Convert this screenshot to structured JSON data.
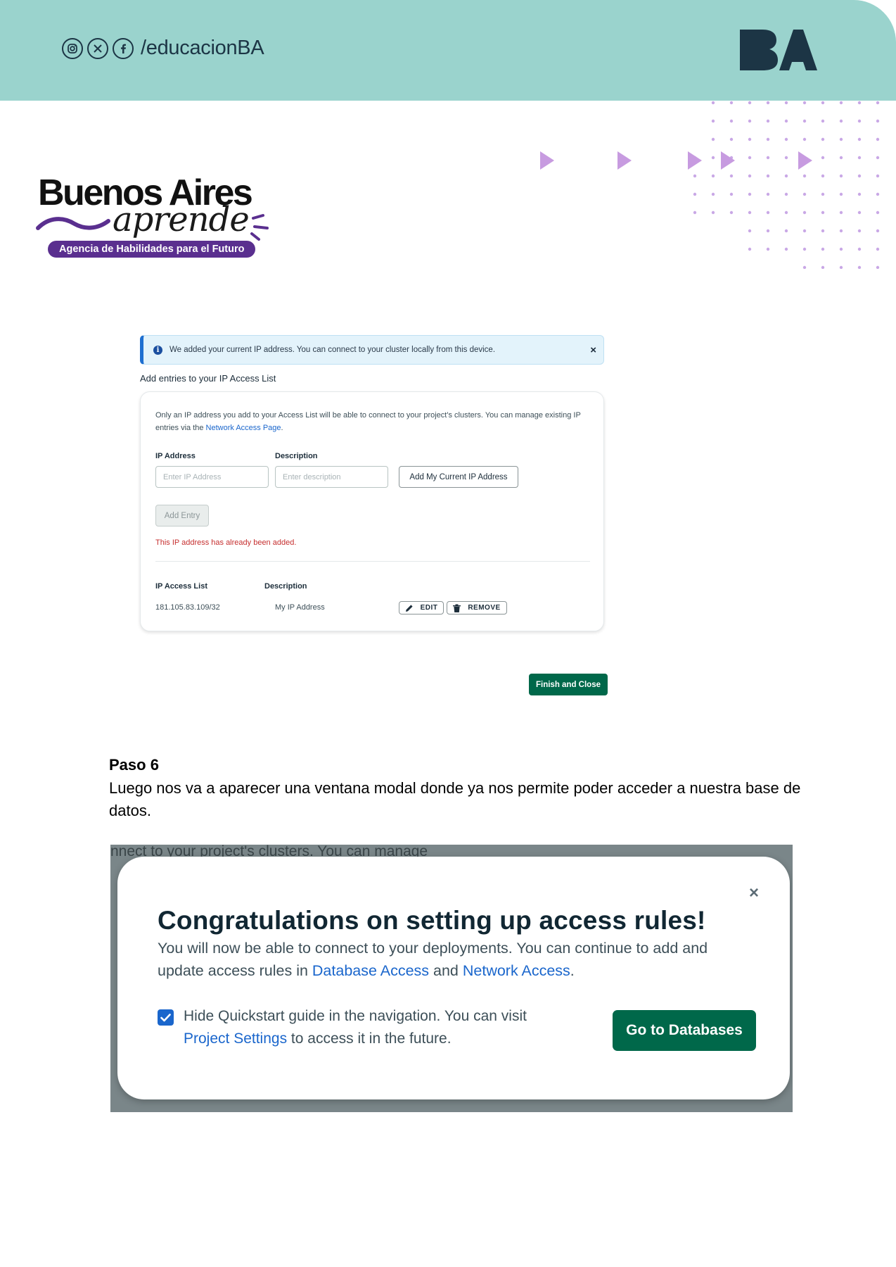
{
  "header": {
    "social_icons": [
      "instagram-icon",
      "x-icon",
      "facebook-icon"
    ],
    "handle": "/educacionBA",
    "logo_text": "BA"
  },
  "brand": {
    "title": "Buenos Aires",
    "script": "aprende",
    "tagline": "Agencia de Habilidades para el Futuro"
  },
  "screenshot1": {
    "alert_text": "We added your current IP address. You can connect to your cluster locally from this device.",
    "alert_close": "×",
    "heading": "Add entries to your IP Access List",
    "desc_prefix": "Only an IP address you add to your Access List will be able to connect to your project's clusters. You can manage existing IP entries via the ",
    "desc_link": "Network Access Page",
    "desc_suffix": ".",
    "ip_label": "IP Address",
    "description_label": "Description",
    "ip_placeholder": "Enter IP Address",
    "description_placeholder": "Enter description",
    "add_current_ip": "Add My Current IP Address",
    "add_entry": "Add Entry",
    "error": "This IP address has already been added.",
    "list_header_ip": "IP Access List",
    "list_header_desc": "Description",
    "entries": [
      {
        "ip": "181.105.83.109/32",
        "description": "My IP Address"
      }
    ],
    "edit_label": "EDIT",
    "remove_label": "REMOVE",
    "finish": "Finish and Close"
  },
  "step": {
    "title": "Paso 6",
    "body": "Luego nos va a aparecer una ventana modal donde ya nos permite poder acceder a nuestra base de datos."
  },
  "screenshot2": {
    "background_text": "nnect to your project's clusters. You can manage",
    "close": "×",
    "title": "Congratulations on setting up access rules!",
    "text_prefix": "You will now be able to connect to your deployments. You can continue to add and update access rules in ",
    "link_database": "Database Access",
    "text_and": " and ",
    "link_network": "Network Access",
    "text_suffix": ".",
    "checkbox_checked": true,
    "checkbox_text_prefix": "Hide Quickstart guide in the navigation. You can visit ",
    "checkbox_link": "Project Settings",
    "checkbox_text_suffix": " to access it in the future.",
    "go_button": "Go to Databases"
  },
  "colors": {
    "header_band": "#9ad3cd",
    "brand_purple": "#5a2f8f",
    "mongo_green": "#00684a",
    "link_blue": "#1a66cc",
    "triangle_purple": "#c79be0"
  }
}
